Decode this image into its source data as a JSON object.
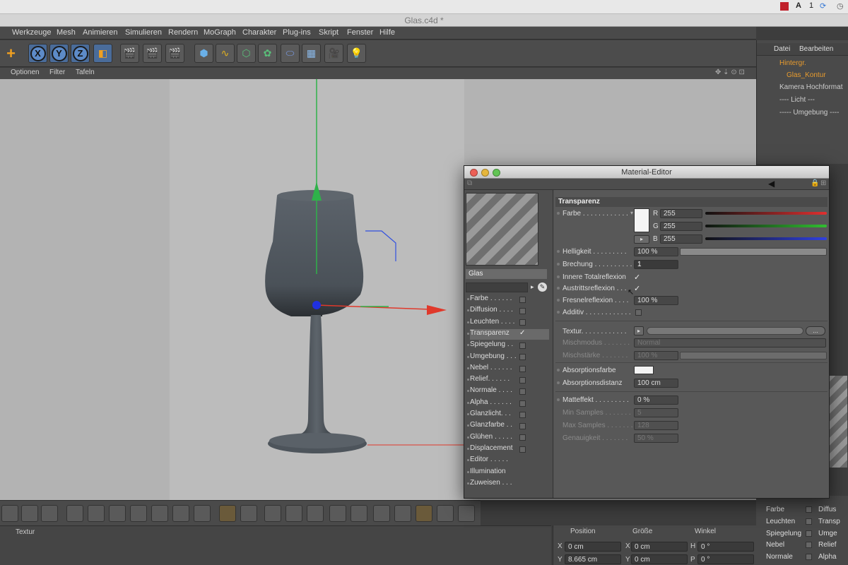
{
  "window": {
    "title": "Glas.c4d *"
  },
  "system": {
    "flag": "1"
  },
  "menu": [
    "Werkzeuge",
    "Mesh",
    "Animieren",
    "Simulieren",
    "Rendern",
    "MoGraph",
    "Charakter",
    "Plug-ins",
    "Skript",
    "Fenster",
    "Hilfe"
  ],
  "toolbar": {
    "x": "X",
    "y": "Y",
    "z": "Z"
  },
  "viewport_menu": [
    "Optionen",
    "Filter",
    "Tafeln"
  ],
  "object_manager": {
    "menu": [
      "Datei",
      "Bearbeiten"
    ],
    "objects": [
      "Hintergr.",
      "Glas_Kontur",
      "Kamera Hochformat",
      "---- Licht ---",
      "----- Umgebung ----"
    ]
  },
  "material_manager_tab": "Textur",
  "material_editor": {
    "title": "Material-Editor",
    "material_name": "Glas",
    "channels": [
      {
        "label": "Farbe . . . . . .",
        "checked": false
      },
      {
        "label": "Diffusion . . . .",
        "checked": false
      },
      {
        "label": "Leuchten . . . .",
        "checked": false
      },
      {
        "label": "Transparenz",
        "checked": true
      },
      {
        "label": "Spiegelung . .",
        "checked": false
      },
      {
        "label": "Umgebung . . .",
        "checked": false
      },
      {
        "label": "Nebel . . . . . .",
        "checked": false
      },
      {
        "label": "Relief. . . . . .",
        "checked": false
      },
      {
        "label": "Normale . . . .",
        "checked": false
      },
      {
        "label": "Alpha . . . . . .",
        "checked": false
      },
      {
        "label": "Glanzlicht. . .",
        "checked": false
      },
      {
        "label": "Glanzfarbe . .",
        "checked": false
      },
      {
        "label": "Glühen . . . . .",
        "checked": false
      },
      {
        "label": "Displacement",
        "checked": false
      },
      {
        "label": "Editor . . . . .",
        "checked": null
      },
      {
        "label": "Illumination",
        "checked": null
      },
      {
        "label": "Zuweisen . . .",
        "checked": null
      }
    ],
    "section_title": "Transparenz",
    "farbe": {
      "label": "Farbe . . . . . . . . . . . .",
      "r": "255",
      "g": "255",
      "b": "255",
      "r_label": "R",
      "g_label": "G",
      "b_label": "B"
    },
    "helligkeit": {
      "label": "Helligkeit . . . . . . . . .",
      "value": "100 %"
    },
    "brechung": {
      "label": "Brechung . . . . . . . . . .",
      "value": "1"
    },
    "innere": {
      "label": "Innere Totalreflexion",
      "check": "✓"
    },
    "austritt": {
      "label": "Austrittsreflexion . . .",
      "check": "✓"
    },
    "fresnel": {
      "label": "Fresnelreflexion . . . .",
      "value": "100 %"
    },
    "additiv": {
      "label": "Additiv . . . . . . . . . . . ."
    },
    "textur": {
      "label": "Textur. . . . . . . . . . . .",
      "more": "..."
    },
    "mischmodus": {
      "label": "Mischmodus . . . . . . .",
      "value": "Normal"
    },
    "mischstaerke": {
      "label": "Mischstärke . . . . . . .",
      "value": "100 %"
    },
    "absorptionsfarbe": {
      "label": "Absorptionsfarbe"
    },
    "absorptionsdistanz": {
      "label": "Absorptionsdistanz",
      "value": "100 cm"
    },
    "matteffekt": {
      "label": "Matteffekt . . . . . . . . .",
      "value": "0 %"
    },
    "min_samples": {
      "label": "Min Samples . . . . . . .",
      "value": "5"
    },
    "max_samples": {
      "label": "Max Samples . . . . . . .",
      "value": "128"
    },
    "genauigkeit": {
      "label": "Genauigkeit . . . . . . .",
      "value": "50 %"
    }
  },
  "attributes": {
    "left": [
      "Farbe",
      "Leuchten",
      "Spiegelung",
      "Nebel",
      "Normale"
    ],
    "right": [
      "Diffus",
      "Transp",
      "Umge",
      "Relief",
      "Alpha"
    ]
  },
  "coordinates": {
    "headers": {
      "pos": "Position",
      "size": "Größe",
      "rot": "Winkel"
    },
    "rows": [
      {
        "axis": "X",
        "pos": "0 cm",
        "size": "0 cm",
        "rlabel": "H",
        "rot": "0 °"
      },
      {
        "axis": "Y",
        "pos": "8.665 cm",
        "size": "0 cm",
        "rlabel": "P",
        "rot": "0 °"
      }
    ]
  },
  "colors": {
    "accent_orange": "#e79b2e",
    "axis_red": "#e0392b",
    "axis_green": "#2fb24a",
    "axis_blue": "#3050e0"
  }
}
